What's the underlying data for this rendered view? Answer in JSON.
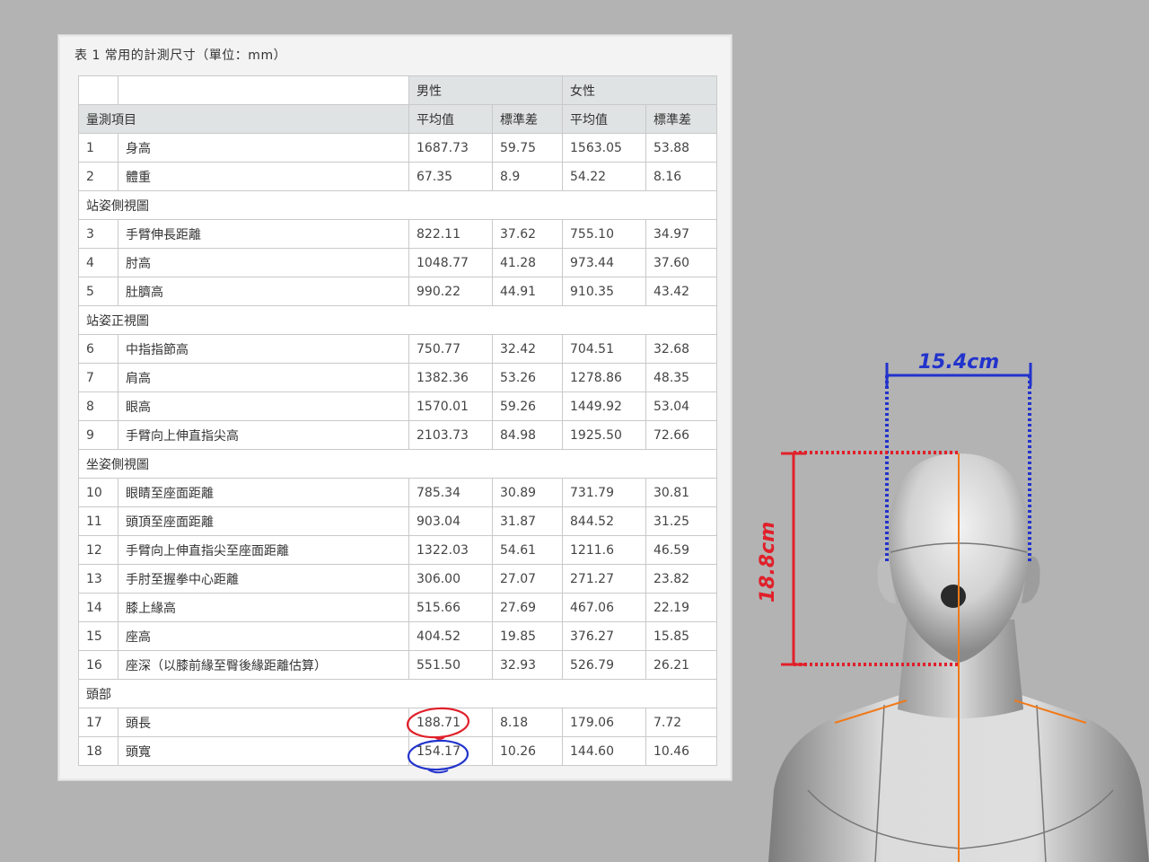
{
  "caption": "表 1 常用的計測尺寸（單位：mm）",
  "table": {
    "group_headers": [
      "男性",
      "女性"
    ],
    "item_header": "量測項目",
    "sub_headers": [
      "平均值",
      "標準差",
      "平均值",
      "標準差"
    ],
    "rows": [
      {
        "no": "1",
        "name": "身高",
        "m_avg": "1687.73",
        "m_sd": "59.75",
        "f_avg": "1563.05",
        "f_sd": "53.88"
      },
      {
        "no": "2",
        "name": "體重",
        "m_avg": "67.35",
        "m_sd": "8.9",
        "f_avg": "54.22",
        "f_sd": "8.16"
      },
      {
        "section": "站姿側視圖"
      },
      {
        "no": "3",
        "name": "手臂伸長距離",
        "m_avg": "822.11",
        "m_sd": "37.62",
        "f_avg": "755.10",
        "f_sd": "34.97"
      },
      {
        "no": "4",
        "name": "肘高",
        "m_avg": "1048.77",
        "m_sd": "41.28",
        "f_avg": "973.44",
        "f_sd": "37.60"
      },
      {
        "no": "5",
        "name": "肚臍高",
        "m_avg": "990.22",
        "m_sd": "44.91",
        "f_avg": "910.35",
        "f_sd": "43.42"
      },
      {
        "section": "站姿正視圖"
      },
      {
        "no": "6",
        "name": "中指指節高",
        "m_avg": "750.77",
        "m_sd": "32.42",
        "f_avg": "704.51",
        "f_sd": "32.68"
      },
      {
        "no": "7",
        "name": "肩高",
        "m_avg": "1382.36",
        "m_sd": "53.26",
        "f_avg": "1278.86",
        "f_sd": "48.35"
      },
      {
        "no": "8",
        "name": "眼高",
        "m_avg": "1570.01",
        "m_sd": "59.26",
        "f_avg": "1449.92",
        "f_sd": "53.04"
      },
      {
        "no": "9",
        "name": "手臂向上伸直指尖高",
        "m_avg": "2103.73",
        "m_sd": "84.98",
        "f_avg": "1925.50",
        "f_sd": "72.66"
      },
      {
        "section": "坐姿側視圖"
      },
      {
        "no": "10",
        "name": "眼睛至座面距離",
        "m_avg": "785.34",
        "m_sd": "30.89",
        "f_avg": "731.79",
        "f_sd": "30.81"
      },
      {
        "no": "11",
        "name": "頭頂至座面距離",
        "m_avg": "903.04",
        "m_sd": "31.87",
        "f_avg": "844.52",
        "f_sd": "31.25"
      },
      {
        "no": "12",
        "name": "手臂向上伸直指尖至座面距離",
        "m_avg": "1322.03",
        "m_sd": "54.61",
        "f_avg": "1211.6",
        "f_sd": "46.59"
      },
      {
        "no": "13",
        "name": "手肘至握拳中心距離",
        "m_avg": "306.00",
        "m_sd": "27.07",
        "f_avg": "271.27",
        "f_sd": "23.82"
      },
      {
        "no": "14",
        "name": "膝上緣高",
        "m_avg": "515.66",
        "m_sd": "27.69",
        "f_avg": "467.06",
        "f_sd": "22.19"
      },
      {
        "no": "15",
        "name": "座高",
        "m_avg": "404.52",
        "m_sd": "19.85",
        "f_avg": "376.27",
        "f_sd": "15.85"
      },
      {
        "no": "16",
        "name": "座深（以膝前緣至臀後緣距離估算）",
        "m_avg": "551.50",
        "m_sd": "32.93",
        "f_avg": "526.79",
        "f_sd": "26.21"
      },
      {
        "section": "頭部"
      },
      {
        "no": "17",
        "name": "頭長",
        "m_avg": "188.71",
        "m_sd": "8.18",
        "f_avg": "179.06",
        "f_sd": "7.72"
      },
      {
        "no": "18",
        "name": "頭寬",
        "m_avg": "154.17",
        "m_sd": "10.26",
        "f_avg": "144.60",
        "f_sd": "10.46"
      }
    ]
  },
  "annotations": {
    "width_label": "15.4cm",
    "height_label": "18.8cm",
    "width_color": "#2233cc",
    "height_color": "#e0202a",
    "centerline_color": "#f07a1a"
  }
}
